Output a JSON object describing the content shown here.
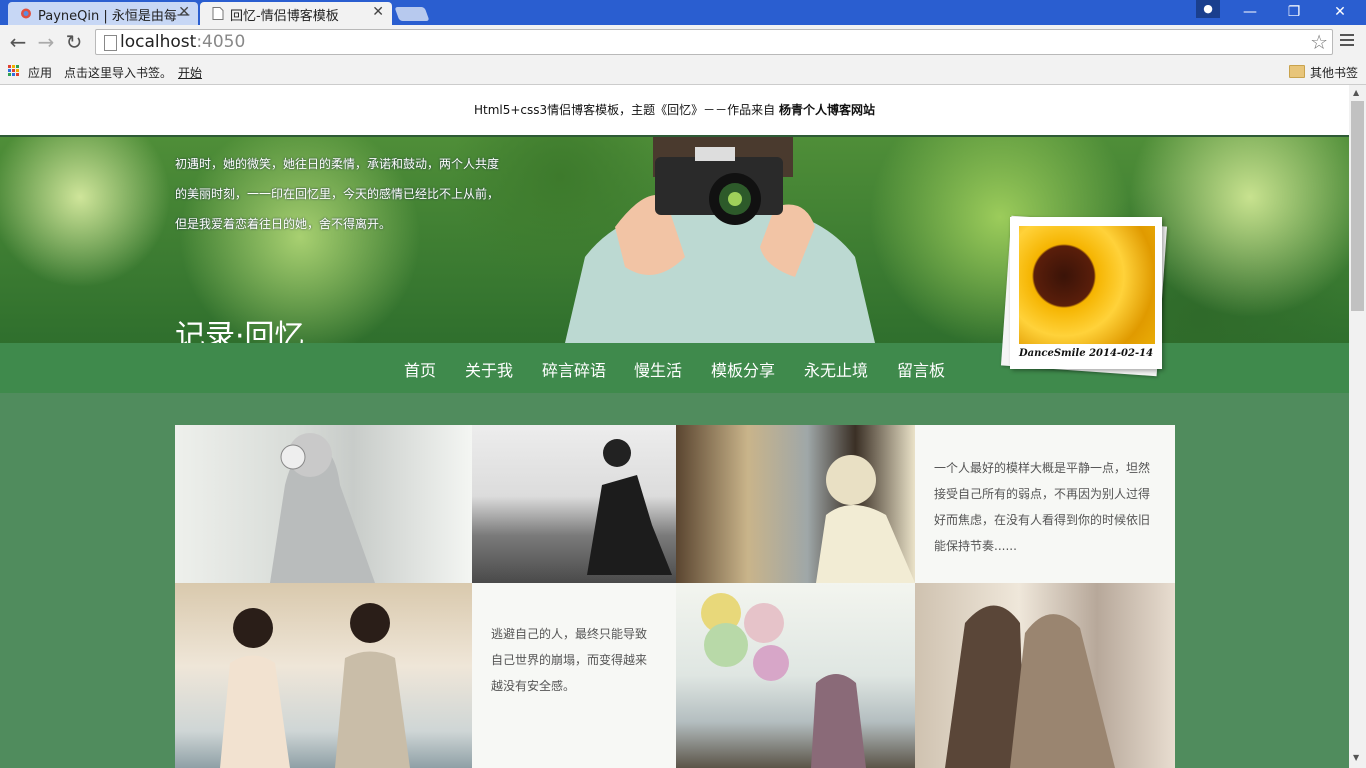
{
  "browser": {
    "tabs": [
      {
        "title": "PayneQin | 永恒是由每一",
        "active": false
      },
      {
        "title": "回忆-情侣博客模板",
        "active": true
      }
    ],
    "url_host": "localhost",
    "url_port": ":4050",
    "bookmarks": {
      "apps": "应用",
      "import": "点击这里导入书签。",
      "start": "开始",
      "other": "其他书签"
    }
  },
  "page": {
    "top_note_prefix": "Html5+css3情侣博客模板，主题《回忆》－－作品来自 ",
    "top_note_author": "杨青个人博客网站",
    "banner_text": "初遇时，她的微笑，她往日的柔情，承诺和鼓动，两个人共度的美丽时刻，一一印在回忆里，今天的感情已经比不上从前，但是我爱着恋着往日的她，舍不得离开。",
    "logo": "记录·回忆",
    "nav": [
      "首页",
      "关于我",
      "碎言碎语",
      "慢生活",
      "模板分享",
      "永无止境",
      "留言板"
    ],
    "polaroid_caption_name": "DanceSmile",
    "polaroid_caption_date": "2014-02-14",
    "gallery_text_1": "一个人最好的模样大概是平静一点，坦然接受自己所有的弱点，不再因为别人过得好而焦虑，在没有人看得到你的时候依旧能保持节奏......",
    "gallery_text_2": "逃避自己的人，最终只能导致自己世界的崩塌，而变得越来越没有安全感。"
  },
  "colors": {
    "chrome_blue": "#2a5ed0",
    "page_green": "#508c5d",
    "nav_green": "#3f8a4c"
  }
}
